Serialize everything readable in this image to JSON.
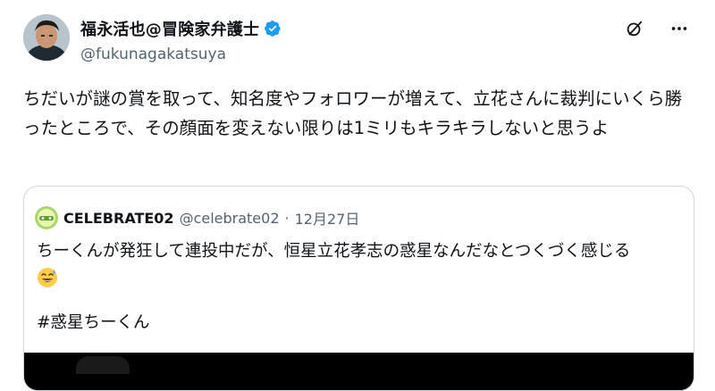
{
  "author": {
    "name": "福永活也@冒険家弁護士",
    "handle": "@fukunagakatsuya"
  },
  "post": {
    "text": "ちだいが謎の賞を取って、知名度やフォロワーが増えて、立花さんに裁判にいくら勝ったところで、その顔面を変えない限りは1ミリもキラキラしないと思うよ"
  },
  "quote": {
    "name": "CELEBRATE02",
    "handle": "@celebrate02",
    "separator": "·",
    "date": "12月27日",
    "text": "ちーくんが発狂して連投中だが、恒星立花孝志の惑星なんだなとつくづく感じる",
    "hashtag": "#惑星ちーくん"
  },
  "icons": {
    "verified": "verified-badge-icon",
    "grok": "grok-icon",
    "more": "more-options-icon",
    "emoji": "sweat-smile-emoji-icon"
  },
  "colors": {
    "verified": "#1d9bf0",
    "secondary_text": "#536471",
    "border": "#cfd9de"
  }
}
